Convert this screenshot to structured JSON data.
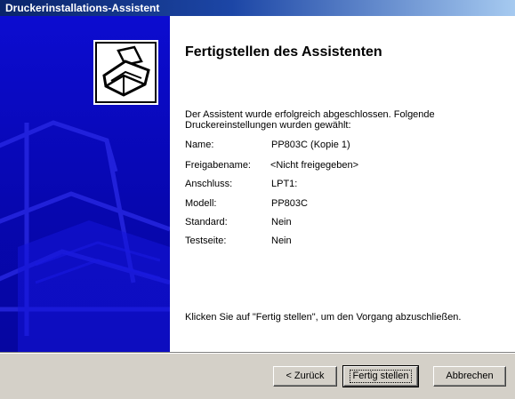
{
  "window": {
    "title": "Druckerinstallations-Assistent"
  },
  "page": {
    "heading": "Fertigstellen des Assistenten",
    "intro": "Der Assistent wurde erfolgreich abgeschlossen. Folgende Druckereinstellungen wurden gewählt:",
    "settings": [
      {
        "label": "Name:",
        "value": "PP803C (Kopie 1)"
      },
      {
        "label": "Freigabename:",
        "value": "<Nicht freigegeben>"
      },
      {
        "label": "Anschluss:",
        "value": "LPT1:"
      },
      {
        "label": "Modell:",
        "value": "PP803C"
      },
      {
        "label": "Standard:",
        "value": "Nein"
      },
      {
        "label": "Testseite:",
        "value": "Nein"
      }
    ],
    "instruction": "Klicken Sie auf \"Fertig stellen\", um den Vorgang abzuschließen."
  },
  "buttons": {
    "back": "< Zurück",
    "finish": "Fertig stellen",
    "cancel": "Abbrechen"
  },
  "icons": {
    "wizard": "printer-icon"
  },
  "colors": {
    "titlebar_start": "#0a246a",
    "watermark": "#0707b0",
    "buttonface": "#d4d0c8"
  }
}
